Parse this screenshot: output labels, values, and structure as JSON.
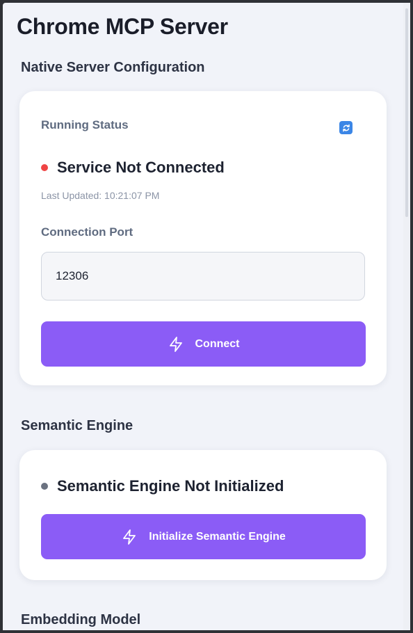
{
  "app": {
    "title": "Chrome MCP Server"
  },
  "native_server": {
    "section_title": "Native Server Configuration",
    "running_status_label": "Running Status",
    "refresh_icon": "refresh-icon",
    "status_text": "Service Not Connected",
    "status_color": "#ef4444",
    "last_updated": "Last Updated: 10:21:07 PM",
    "port_label": "Connection Port",
    "port_value": "12306",
    "connect_label": "Connect",
    "connect_icon": "lightning-bolt-icon"
  },
  "semantic_engine": {
    "section_title": "Semantic Engine",
    "status_text": "Semantic Engine Not Initialized",
    "status_color": "#6b7280",
    "initialize_label": "Initialize Semantic Engine",
    "initialize_icon": "lightning-bolt-icon"
  },
  "embedding_model": {
    "section_title": "Embedding Model"
  },
  "colors": {
    "accent": "#8b5cf6",
    "background": "#f1f3f9",
    "card": "#ffffff"
  }
}
